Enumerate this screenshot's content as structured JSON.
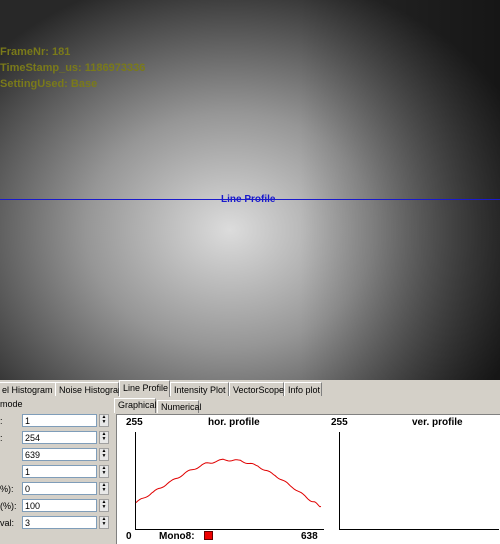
{
  "overlay": {
    "frame": "FrameNr: 181",
    "timestamp": "TimeStamp_us: 1186973336",
    "setting": "SettingUsed: Base",
    "profile_label": "Line Profile"
  },
  "tabs": [
    {
      "label": "el Histogram"
    },
    {
      "label": "Noise Histogram"
    },
    {
      "label": "Line Profile",
      "active": true
    },
    {
      "label": "Intensity Plot"
    },
    {
      "label": "VectorScope"
    },
    {
      "label": "Info plot"
    }
  ],
  "settings": {
    "mode_label": "mode",
    "rows": [
      {
        "label": ":",
        "value": "1"
      },
      {
        "label": ":",
        "value": "254"
      },
      {
        "label": "",
        "value": "639"
      },
      {
        "label": "",
        "value": "1"
      },
      {
        "label": "%):",
        "value": "0"
      },
      {
        "label": "(%):",
        "value": "100"
      },
      {
        "label": "val:",
        "value": "3"
      }
    ]
  },
  "subtabs": {
    "graphical": "Graphical",
    "numerical": "Numerical"
  },
  "hor_profile": {
    "title": "hor. profile",
    "ymax": "255",
    "xmin": "0",
    "xmax": "638",
    "legend": "Mono8:",
    "color": "#e00000"
  },
  "ver_profile": {
    "title": "ver. profile",
    "ymax": "255"
  },
  "chart_data": {
    "type": "line",
    "title": "hor. profile",
    "xlim": [
      0,
      638
    ],
    "ylim": [
      0,
      255
    ],
    "series": [
      {
        "name": "Mono8",
        "x": [
          0,
          60,
          120,
          180,
          240,
          300,
          360,
          420,
          480,
          540,
          600,
          638
        ],
        "y": [
          68,
          95,
          122,
          148,
          168,
          178,
          176,
          162,
          138,
          108,
          75,
          58
        ]
      }
    ]
  }
}
